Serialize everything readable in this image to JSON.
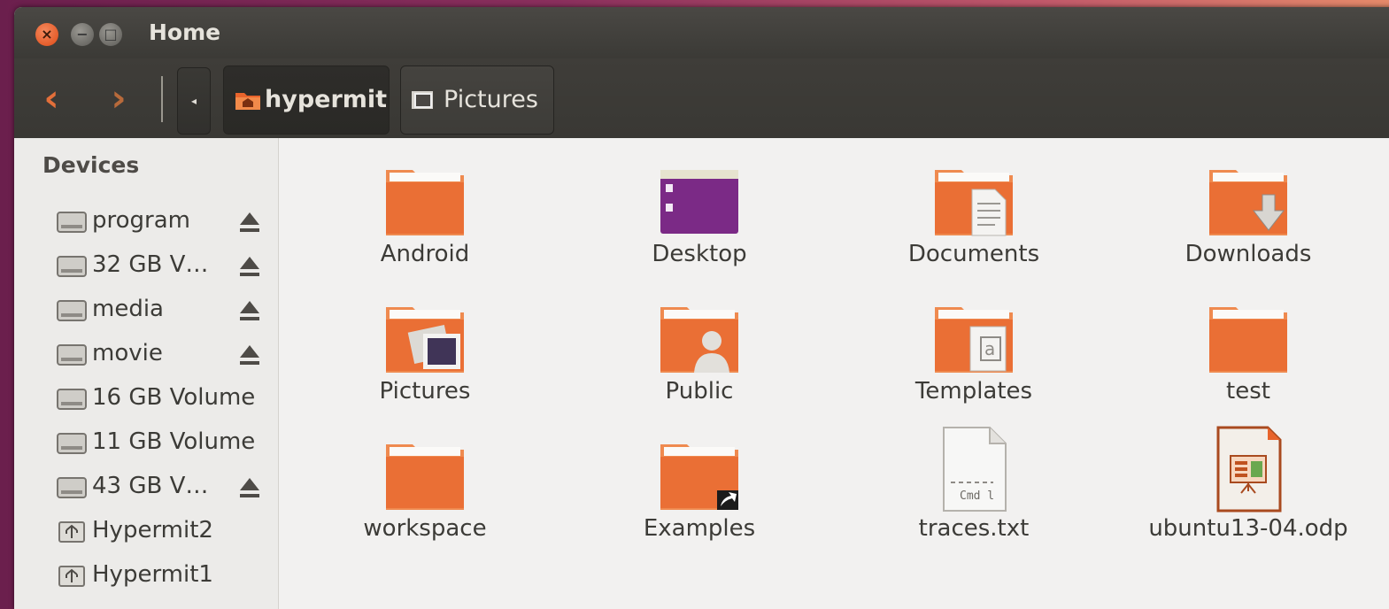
{
  "window": {
    "title": "Home",
    "buttons": {
      "close": "×",
      "minimize": "−",
      "maximize": "□"
    }
  },
  "toolbar": {
    "back_icon": "‹",
    "forward_icon": "›",
    "crumb_left_arrow": "◂",
    "breadcrumbs": [
      {
        "label": "hypermit",
        "icon": "home-folder-icon",
        "active": true
      },
      {
        "label": "Pictures",
        "icon": "pictures-folder-icon",
        "active": false
      }
    ]
  },
  "sidebar": {
    "header": "Devices",
    "items": [
      {
        "label": "program",
        "icon": "drive-icon",
        "eject": true
      },
      {
        "label": "32 GB V…",
        "icon": "drive-icon",
        "eject": true
      },
      {
        "label": "media",
        "icon": "drive-icon",
        "eject": true
      },
      {
        "label": "movie",
        "icon": "drive-icon",
        "eject": true
      },
      {
        "label": "16 GB Volume",
        "icon": "drive-icon",
        "eject": false
      },
      {
        "label": "11 GB Volume",
        "icon": "drive-icon",
        "eject": false
      },
      {
        "label": "43 GB V…",
        "icon": "drive-icon",
        "eject": true
      },
      {
        "label": "Hypermit2",
        "icon": "usb-drive-icon",
        "eject": false
      },
      {
        "label": "Hypermit1",
        "icon": "usb-drive-icon",
        "eject": false
      }
    ]
  },
  "files": [
    {
      "name": "Android",
      "icon": "folder-icon"
    },
    {
      "name": "Desktop",
      "icon": "desktop-folder-icon"
    },
    {
      "name": "Documents",
      "icon": "documents-folder-icon"
    },
    {
      "name": "Downloads",
      "icon": "downloads-folder-icon"
    },
    {
      "name": "Pictures",
      "icon": "pictures-folder-icon"
    },
    {
      "name": "Public",
      "icon": "public-folder-icon"
    },
    {
      "name": "Templates",
      "icon": "templates-folder-icon"
    },
    {
      "name": "test",
      "icon": "folder-icon"
    },
    {
      "name": "workspace",
      "icon": "folder-icon"
    },
    {
      "name": "Examples",
      "icon": "examples-link-folder-icon"
    },
    {
      "name": "traces.txt",
      "icon": "text-file-icon",
      "preview_text": "Cmd l"
    },
    {
      "name": "ubuntu13-04.odp",
      "icon": "presentation-file-icon"
    }
  ],
  "colors": {
    "accent": "#e8642c",
    "folder_light": "#f6a56b",
    "folder_dark": "#e2602a"
  }
}
